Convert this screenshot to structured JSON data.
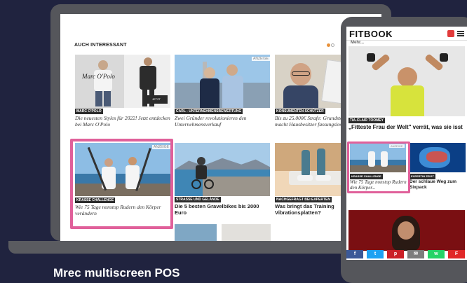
{
  "laptop": {
    "section_title": "AUCH INTERESSANT",
    "ad_label": "ANZEIGE",
    "cards": [
      {
        "tag": "MARC O'POLO",
        "caption": "Die neuesten Styles für 2022! Jetzt entdecken bei Marc O'Polo",
        "style": "italic",
        "image_text": "Marc O'Polo",
        "button_text": "JETZT ENTDECKEN"
      },
      {
        "tag": "CARL - UNTERNEHMENSBEWERTUNG",
        "caption": "Zwei Gründer revolutionieren den Unternehmensverkauf",
        "style": "italic"
      },
      {
        "tag": "KONSUMENTEN SCHÜTZER",
        "caption": "Bis zu 25.000€ Strafe: Grundsteuer-Gesetz macht Hausbesitzer fassungslos",
        "style": "italic"
      },
      {
        "tag": "KRASSE CHALLENGE",
        "caption": "Wie 75 Tage nonstop Rudern den Körper verändern",
        "style": "italic"
      },
      {
        "tag": "STRASSE UND GELÄNDE",
        "caption": "Die 5 besten Gravelbikes bis 2000 Euro",
        "style": "bold"
      },
      {
        "tag": "NACHGEFRAGT BEI EXPERTEN",
        "caption": "Was bringt das Training Vibrationsplatten?",
        "style": "bold"
      }
    ]
  },
  "phone": {
    "brand": "FITBOOK",
    "top_text": "Mehr...",
    "hero_tag": "TIA-CLAIR TOOMEY",
    "hero_headline": "„Fitteste Frau der Welt\" verrät, was sie isst",
    "ad_label": "ANZEIGE",
    "card_left_tag": "KRASSE CHALLENGE",
    "card_left_caption": "Wie 75 Tage nonstop Rudern den Körper...",
    "card_right_tag": "EXPERTIN ZEIGT",
    "card_right_caption": "Der schlaue Weg zum Sixpack",
    "share_buttons": [
      {
        "name": "facebook",
        "glyph": "f",
        "color": "#3b5998"
      },
      {
        "name": "twitter",
        "glyph": "t",
        "color": "#1da1f2"
      },
      {
        "name": "pinterest",
        "glyph": "p",
        "color": "#cb2027"
      },
      {
        "name": "email",
        "glyph": "✉",
        "color": "#7d7d7d"
      },
      {
        "name": "whatsapp",
        "glyph": "w",
        "color": "#25d366"
      },
      {
        "name": "flipboard",
        "glyph": "F",
        "color": "#e12828"
      }
    ]
  },
  "footer": {
    "title": "Mrec multiscreen POS"
  },
  "colors": {
    "background": "#20233f",
    "highlight": "#e0609a",
    "device": "#55565b"
  }
}
